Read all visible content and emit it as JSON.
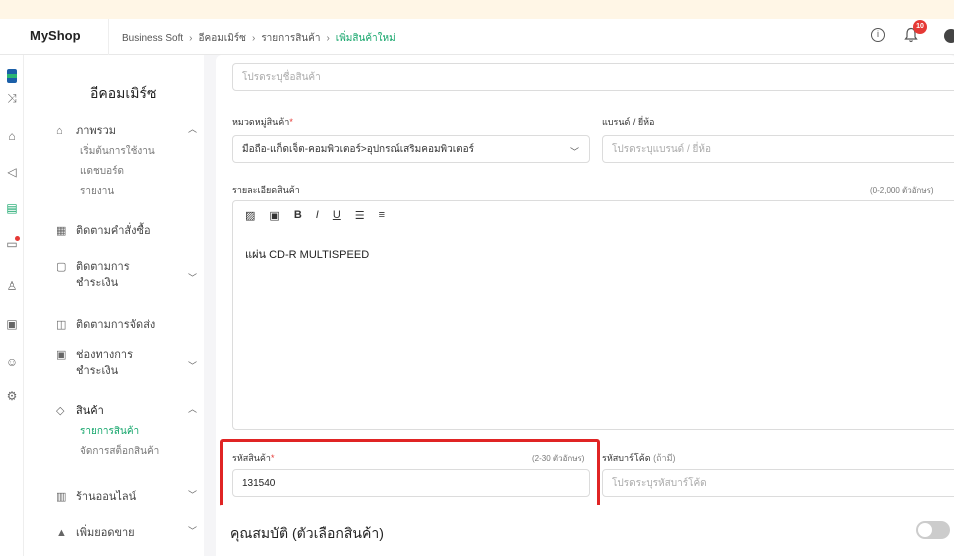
{
  "header": {
    "brand": "MyShop",
    "breadcrumb": [
      "Business Soft",
      "อีคอมเมิร์ซ",
      "รายการสินค้า",
      "เพิ่มสินค้าใหม่"
    ],
    "notification_count": "10"
  },
  "sidebar": {
    "title": "อีคอมเมิร์ซ",
    "overview": "ภาพรวม",
    "overview_subs": [
      "เริ่มต้นการใช้งาน",
      "แดชบอร์ด",
      "รายงาน"
    ],
    "order_tracking": "ติดตามคำสั่งซื้อ",
    "payment_tracking": [
      "ติดตามการ",
      "ชำระเงิน"
    ],
    "shipping_tracking": "ติดตามการจัดส่ง",
    "payment_channels": [
      "ช่องทางการ",
      "ชำระเงิน"
    ],
    "products": "สินค้า",
    "product_subs": [
      "รายการสินค้า",
      "จัดการสต็อกสินค้า"
    ],
    "online_store": "ร้านออนไลน์",
    "increase_sales": "เพิ่มยอดขาย"
  },
  "form": {
    "product_name_placeholder": "โปรดระบุชื่อสินค้า",
    "category_label": "หมวดหมู่สินค้า",
    "category_value": "มือถือ-แก็ดเจ็ต-คอมพิวเตอร์>อุปกรณ์เสริมคอมพิวเตอร์",
    "brand_label": "แบรนด์ / ยี่ห้อ",
    "brand_placeholder": "โปรดระบุแบรนด์ / ยี่ห้อ",
    "description_label": "รายละเอียดสินค้า",
    "description_limit": "(0-2,000 ตัวอักษร)",
    "toolbar": [
      "B",
      "I",
      "U"
    ],
    "description_value": "แผ่น CD-R MULTISPEED",
    "sku_label": "รหัสสินค้า",
    "sku_limit": "(2-30 ตัวอักษร)",
    "sku_value": "131540",
    "barcode_label": "รหัสบาร์โค้ด",
    "barcode_optional": "(ถ้ามี)",
    "barcode_placeholder": "โปรดระบุรหัสบาร์โค้ด",
    "required_mark": "*"
  },
  "variant": {
    "title": "คุณสมบัติ (ตัวเลือกสินค้า)"
  }
}
